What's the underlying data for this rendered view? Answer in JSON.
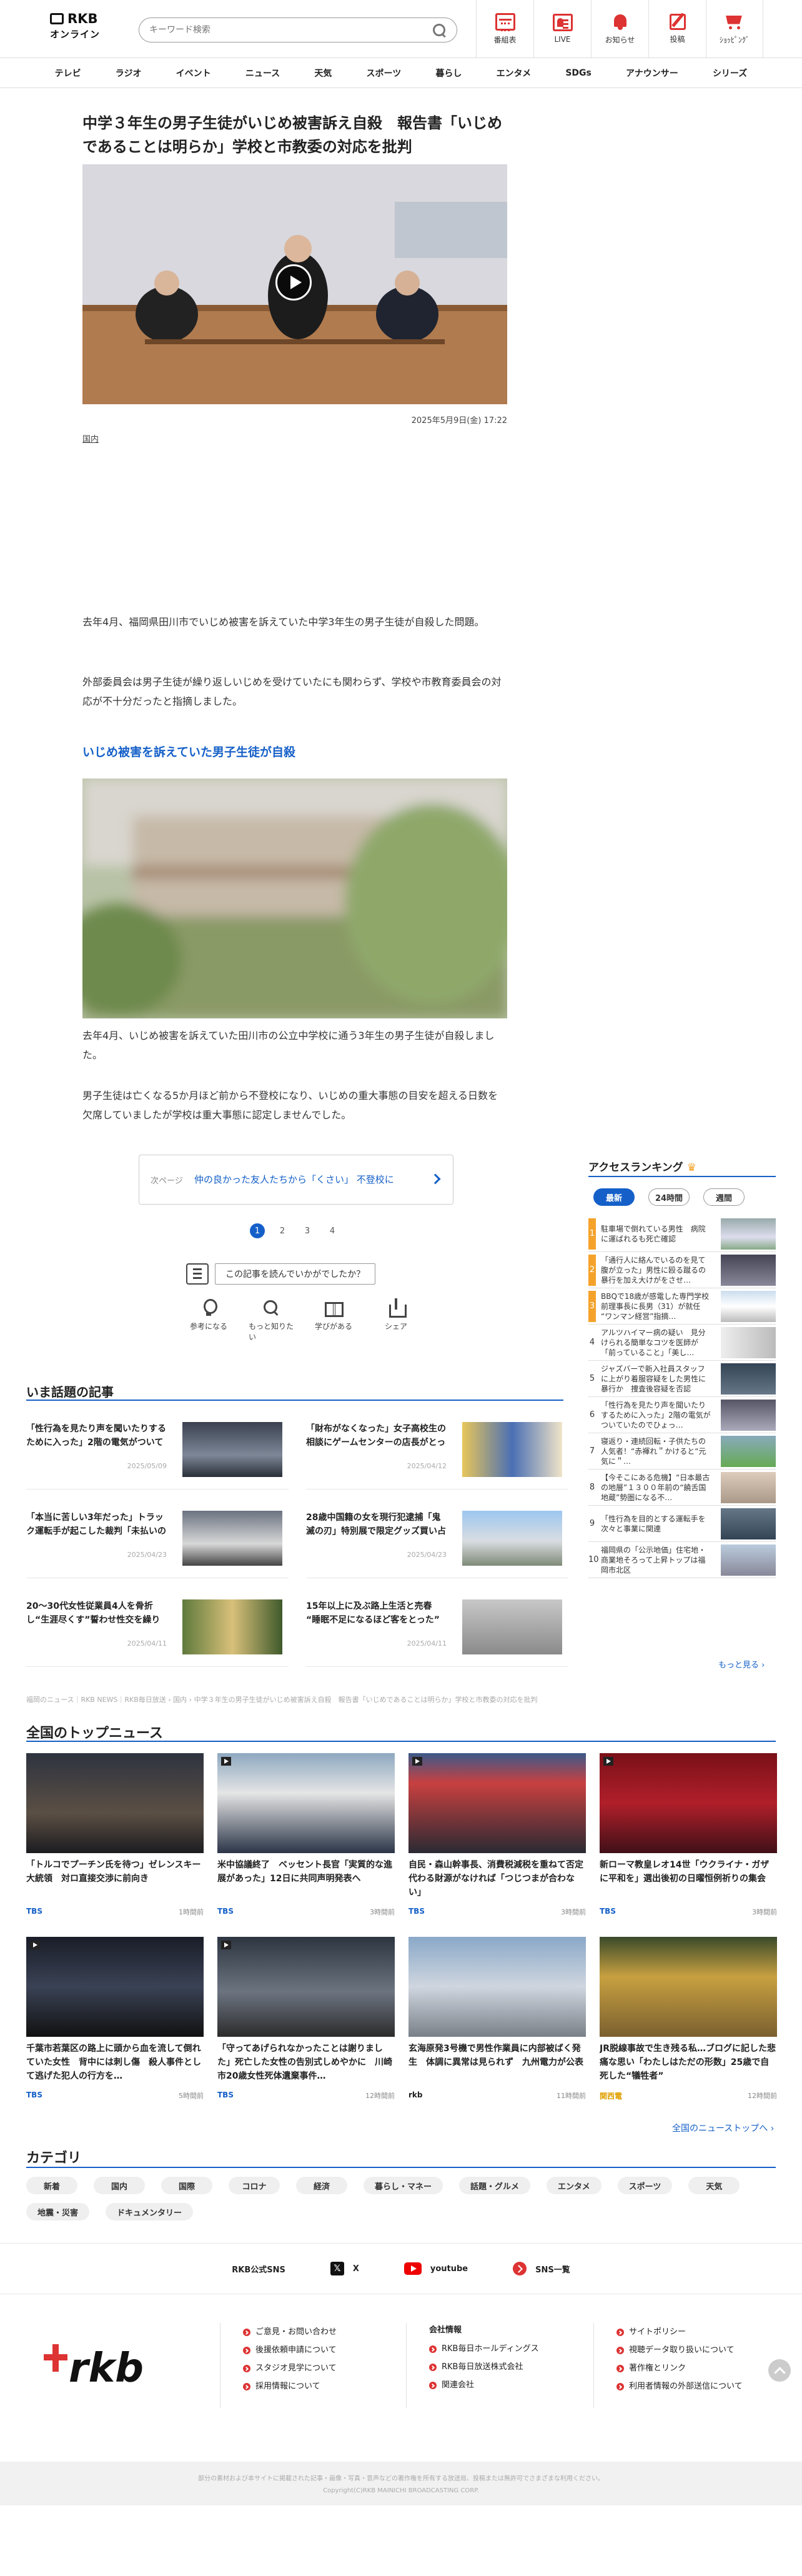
{
  "header": {
    "logo_main": "RKB",
    "logo_sub": "オンライン",
    "search_placeholder": "キーワード検索",
    "icons": [
      {
        "name": "program-guide",
        "label": "番組表",
        "icon": "calendar-icon"
      },
      {
        "name": "live",
        "label": "LIVE",
        "icon": "live-icon"
      },
      {
        "name": "notice",
        "label": "お知らせ",
        "icon": "bell-icon"
      },
      {
        "name": "post",
        "label": "投稿",
        "icon": "post-icon"
      },
      {
        "name": "shopping",
        "label": "ｼｮｯﾋﾟﾝｸﾞ",
        "icon": "cart-icon"
      }
    ]
  },
  "nav": [
    "テレビ",
    "ラジオ",
    "イベント",
    "ニュース",
    "天気",
    "スポーツ",
    "暮らし",
    "エンタメ",
    "SDGs",
    "アナウンサー",
    "シリーズ"
  ],
  "article": {
    "title": "中学３年生の男子生徒がいじめ被害訴え自殺　報告書「いじめであることは明らか」学校と市教委の対応を批判",
    "date": "2025年5月9日(金) 17:22",
    "category": "国内",
    "p1": "去年4月、福岡県田川市でいじめ被害を訴えていた中学3年生の男子生徒が自殺した問題。",
    "p2": "外部委員会は男子生徒が繰り返しいじめを受けていたにも関わらず、学校や市教育委員会の対応が不十分だったと指摘しました。",
    "subheading": "いじめ被害を訴えていた男子生徒が自殺",
    "p3": "去年4月、いじめ被害を訴えていた田川市の公立中学校に通う3年生の男子生徒が自殺しました。",
    "p4": "男子生徒は亡くなる5か月ほど前から不登校になり、いじめの重大事態の目安を超える日数を欠席していましたが学校は重大事態に認定しませんでした。",
    "next_label": "次ページ",
    "next_text": "仲の良かった友人たちから「くさい」 不登校に",
    "pages": [
      "1",
      "2",
      "3",
      "4"
    ],
    "question": "この記事を読んでいかがでしたか？",
    "reactions": [
      {
        "label": "参考になる",
        "icon": "lightbulb-icon"
      },
      {
        "label": "もっと知りたい",
        "icon": "magnifier-icon"
      },
      {
        "label": "学びがある",
        "icon": "book-icon"
      },
      {
        "label": "シェア",
        "icon": "share-icon"
      }
    ]
  },
  "ranking": {
    "title": "アクセスランキング",
    "tabs": [
      "最新",
      "24時間",
      "週間"
    ],
    "items": [
      {
        "rank": "1",
        "text": "駐車場で倒れている男性　病院に運ばれるも死亡確認"
      },
      {
        "rank": "2",
        "text": "「通行人に絡んでいるのを見て腹が立った」男性に殴る蹴るの暴行を加え大けがをさせ…"
      },
      {
        "rank": "3",
        "text": "BBQで18歳が感電した専門学校　前理事長に長男（31）が就任 “ワンマン経営”指摘…"
      },
      {
        "rank": "4",
        "text": "アルツハイマー病の疑い　見分けられる簡単なコツを医師が「前っていること」「美し…"
      },
      {
        "rank": "5",
        "text": "ジャズバーで新入社員スタッフに上がり着服容疑をした男性に暴行か　捜査後容疑を否認"
      },
      {
        "rank": "6",
        "text": "「性行為を見たり声を聞いたりするために入った」2階の電気がついていたのでひょっ…"
      },
      {
        "rank": "7",
        "text": "寝返り・連続回転・子供たちの人気者！“赤褌れ＂かけると“元気に＂…"
      },
      {
        "rank": "8",
        "text": "【今そこにある危機】“日本最古の地層”１３００年前の“饒舌国地蔵”勢圏になる不…"
      },
      {
        "rank": "9",
        "text": "「性行為を目的とする運転手を次々と事業に関連"
      },
      {
        "rank": "10",
        "text": "福岡県の「公示地価」住宅地・商業地そろって上昇トップは福岡市北区"
      }
    ],
    "more": "もっと見る ›"
  },
  "trending": {
    "title": "いま話題の記事",
    "items": [
      {
        "text": "「性行為を見たり声を聞いたりするために入った」2階の電気がついていたのでひょっと…",
        "date": "2025/05/09"
      },
      {
        "text": "「財布がなくなった」女子高校生の相談にゲームセンターの店長がとった“とっさの…",
        "date": "2025/04/12"
      },
      {
        "text": "「本当に苦しい3年だった」トラック運転手が起こした裁判「未払いの賃金を支払って」…",
        "date": "2025/04/23"
      },
      {
        "text": "28歳中国籍の女を現行犯逮捕「鬼滅の刃」特別展で限定グッズ買い占めようとして新…",
        "date": "2025/04/23"
      },
      {
        "text": "20～30代女性従業員4人を骨折し“生涯尽くす”誓わせ性交を繰り返した事件　ベット…",
        "date": "2025/04/11"
      },
      {
        "text": "15年以上に及ぶ路上生活と売春 “睡眠不足になるほど客をとった” 姉への強姦殺…",
        "date": "2025/04/11"
      }
    ]
  },
  "breadcrumb": "福岡のニュース｜RKB NEWS｜RKB毎日放送 › 国内 › 中学３年生の男子生徒がいじめ被害訴え自殺　報告書「いじめであることは明らか」学校と市教委の対応を批判",
  "national": {
    "title": "全国のトップニュース",
    "items": [
      {
        "caption": "「トルコでプーチン氏を待つ」ゼレンスキー大統領　対ロ直接交渉に前向き",
        "source": "TBS",
        "time": "1時間前"
      },
      {
        "caption": "米中協議終了　ベッセント長官「実質的な進展があった」12日に共同声明発表へ",
        "source": "TBS",
        "time": "3時間前"
      },
      {
        "caption": "自民・森山幹事長、消費税減税を重ねて否定　代わる財源がなければ「つじつまが合わない」",
        "source": "TBS",
        "time": "3時間前"
      },
      {
        "caption": "新ローマ教皇レオ14世「ウクライナ・ガザに平和を」選出後初の日曜恒例祈りの集会",
        "source": "TBS",
        "time": "3時間前"
      },
      {
        "caption": "千葉市若葉区の路上に頭から血を流して倒れていた女性　背中には刺し傷　殺人事件として逃げた犯人の行方を…",
        "source": "TBS",
        "time": "5時間前"
      },
      {
        "caption": "「守ってあげられなかったことは謝りました」死亡した女性の告別式しめやかに　川崎市20歳女性死体遺棄事件…",
        "source": "TBS",
        "time": "12時間前"
      },
      {
        "caption": "玄海原発3号機で男性作業員に内部被ばく発生　体調に異常は見られず　九州電力が公表",
        "source": "rkb",
        "time": "11時間前"
      },
      {
        "caption": "JR脱線事故で生き残る私…ブログに記した悲痛な思い「わたしはただの形数」25歳で自死した“犠牲者”",
        "source": "関西電",
        "time": "12時間前"
      }
    ],
    "more": "全国のニューストップへ ›"
  },
  "categories": {
    "title": "カテゴリ",
    "items": [
      "新着",
      "国内",
      "国際",
      "コロナ",
      "経済",
      "暮らし・マネー",
      "話題・グルメ",
      "エンタメ",
      "スポーツ",
      "天気",
      "地震・災害",
      "ドキュメンタリー"
    ]
  },
  "sns": {
    "label": "RKB公式SNS",
    "x": "X",
    "youtube": "youtube",
    "list": "SNS一覧"
  },
  "footer": {
    "col1": [
      "ご意見・お問い合わせ",
      "後援依頼申請について",
      "スタジオ見学について",
      "採用情報について"
    ],
    "col2_title": "会社情報",
    "col2": [
      "RKB毎日ホールディングス",
      "RKB毎日放送株式会社",
      "関連会社"
    ],
    "col3": [
      "サイトポリシー",
      "視聴データ取り扱いについて",
      "著作権とリンク",
      "利用者情報の外部送信について"
    ],
    "note": "部分の素材および本サイトに掲載された記事・画像・写真・音声などの著作権を所有する放送局、投稿または無許可でさまざまな利用ください。",
    "copyright": "Copyright(C)RKB MAINICHI BROADCASTING CORP."
  },
  "colors": {
    "accent": "#1560c8",
    "brand": "#d33333",
    "rank_top": "#f5a22a"
  }
}
